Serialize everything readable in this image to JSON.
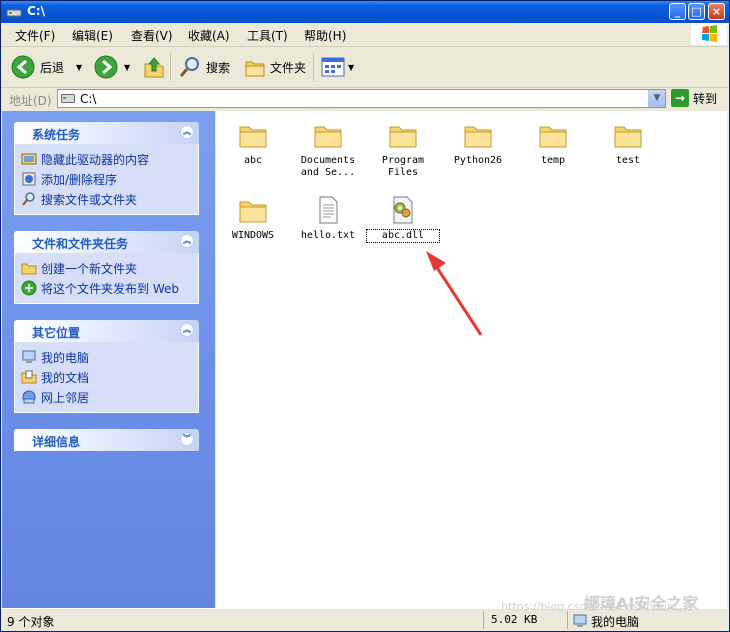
{
  "window": {
    "title": "C:\\"
  },
  "menu": [
    {
      "label": "文件(F)"
    },
    {
      "label": "编辑(E)"
    },
    {
      "label": "查看(V)"
    },
    {
      "label": "收藏(A)"
    },
    {
      "label": "工具(T)"
    },
    {
      "label": "帮助(H)"
    }
  ],
  "toolbar": {
    "back_label": "后退",
    "search_label": "搜索",
    "folders_label": "文件夹"
  },
  "address": {
    "label": "地址(D)",
    "value": "C:\\",
    "go_label": "转到"
  },
  "tasks": {
    "system": {
      "title": "系统任务",
      "items": [
        {
          "label": "隐藏此驱动器的内容"
        },
        {
          "label": "添加/删除程序"
        },
        {
          "label": "搜索文件或文件夹"
        }
      ]
    },
    "file": {
      "title": "文件和文件夹任务",
      "items": [
        {
          "label": "创建一个新文件夹"
        },
        {
          "label": "将这个文件夹发布到 Web"
        }
      ]
    },
    "other": {
      "title": "其它位置",
      "items": [
        {
          "label": "我的电脑"
        },
        {
          "label": "我的文档"
        },
        {
          "label": "网上邻居"
        }
      ]
    },
    "details": {
      "title": "详细信息"
    }
  },
  "files": [
    {
      "name": "abc",
      "type": "folder"
    },
    {
      "name": "Documents\nand Se...",
      "type": "folder"
    },
    {
      "name": "Program\nFiles",
      "type": "folder"
    },
    {
      "name": "Python26",
      "type": "folder"
    },
    {
      "name": "temp",
      "type": "folder"
    },
    {
      "name": "test",
      "type": "folder"
    },
    {
      "name": "WINDOWS",
      "type": "folder"
    },
    {
      "name": "hello.txt",
      "type": "text"
    },
    {
      "name": "abc.dll",
      "type": "dll"
    }
  ],
  "status": {
    "count": "9 个对象",
    "size": "5.02 KB",
    "location": "我的电脑"
  },
  "watermark": {
    "brand": "娜璋AI安全之家",
    "url": "https://blog.csdn.net/Eastmount"
  },
  "colors": {
    "titlebar": "#0a5fe0",
    "taskpane": "#6a8ee8",
    "task_link": "#0c32a7",
    "arrow": "#e53935"
  }
}
